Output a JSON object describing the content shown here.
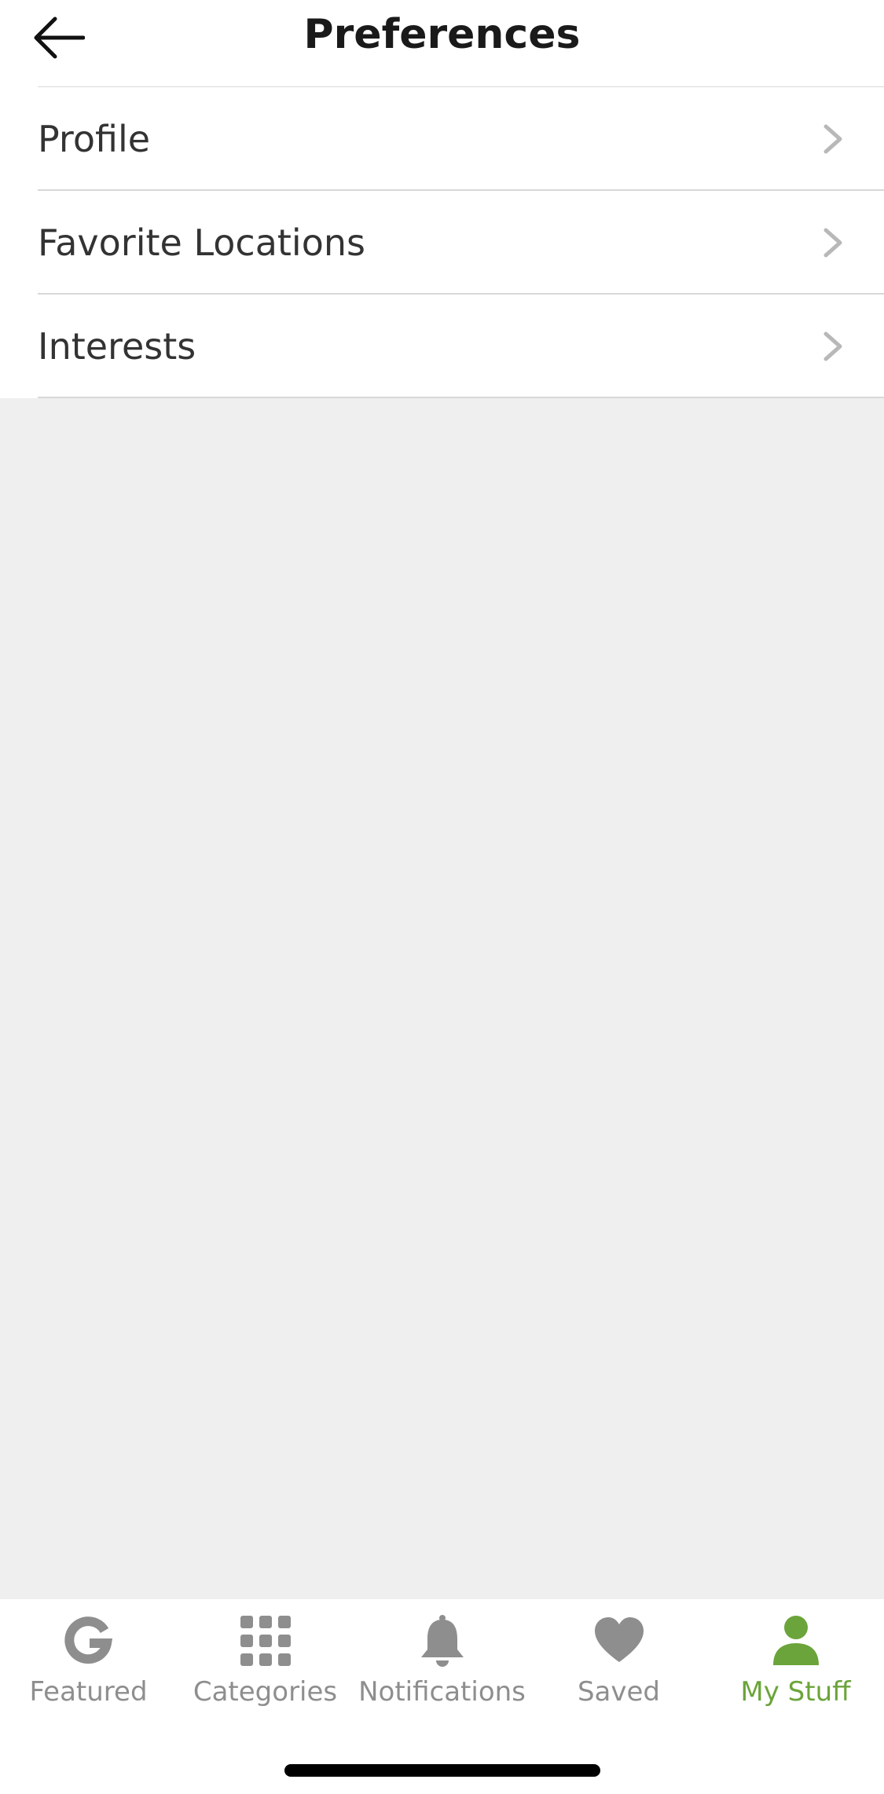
{
  "header": {
    "title": "Preferences",
    "back_icon": "arrow-left-icon"
  },
  "list": {
    "items": [
      {
        "label": "Profile",
        "icon": "chevron-right-icon"
      },
      {
        "label": "Favorite Locations",
        "icon": "chevron-right-icon"
      },
      {
        "label": "Interests",
        "icon": "chevron-right-icon"
      }
    ]
  },
  "tabbar": {
    "tabs": [
      {
        "label": "Featured",
        "icon": "g-logo-icon",
        "active": false
      },
      {
        "label": "Categories",
        "icon": "grid-icon",
        "active": false
      },
      {
        "label": "Notifications",
        "icon": "bell-icon",
        "active": false
      },
      {
        "label": "Saved",
        "icon": "heart-icon",
        "active": false
      },
      {
        "label": "My Stuff",
        "icon": "person-icon",
        "active": true
      }
    ]
  },
  "colors": {
    "active_tab": "#6ba43a",
    "inactive_tab": "#8e8e8e",
    "background": "#efefef"
  }
}
